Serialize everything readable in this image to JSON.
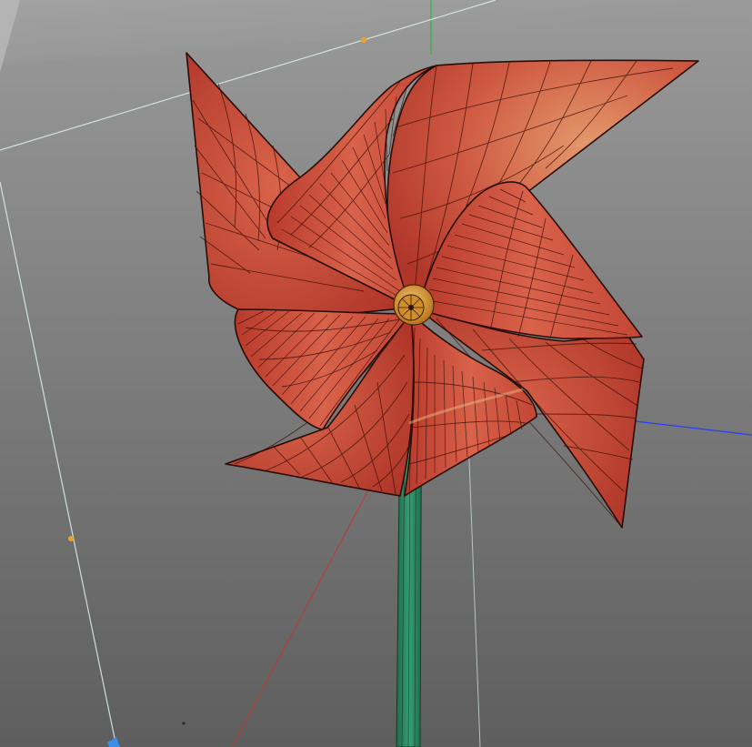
{
  "viewport": {
    "colors": {
      "background_top": "#9a9a9a",
      "background_bottom": "#5e5e5e",
      "blade_light": "#e08a5c",
      "blade_mid": "#c94a38",
      "blade_dark": "#a32c22",
      "wire": "#3a0f0a",
      "hub": "#e5a63a",
      "stick": "#2f8a62",
      "axis_y": "#2fb04a",
      "axis_x": "#2a3cff",
      "axis_z": "#c0392b",
      "guide": "#d6ecea",
      "handle": "#f2a022"
    },
    "objects": {
      "pinwheel": "pinwheel-mesh",
      "stick": "stick-mesh",
      "hub": "hub-mesh"
    }
  }
}
